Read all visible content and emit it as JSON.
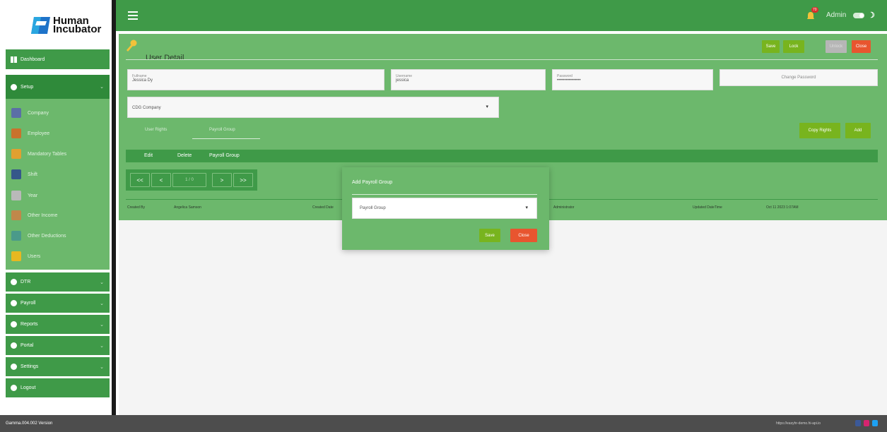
{
  "brand": {
    "line1": "Human",
    "line2": "Incubator"
  },
  "sidebar": {
    "dashboard": "Dashboard",
    "setup": "Setup",
    "setup_items": [
      {
        "label": "Company",
        "color": "#5b6fa6"
      },
      {
        "label": "Employee",
        "color": "#c9722c"
      },
      {
        "label": "Mandatory Tables",
        "color": "#e0a030"
      },
      {
        "label": "Shift",
        "color": "#35588a"
      },
      {
        "label": "Year",
        "color": "#b9b9b9"
      },
      {
        "label": "Other Income",
        "color": "#c0884a"
      },
      {
        "label": "Other Deductions",
        "color": "#4a9a8a"
      },
      {
        "label": "Users",
        "color": "#e8b820"
      }
    ],
    "menu": [
      {
        "label": "DTR"
      },
      {
        "label": "Payroll"
      },
      {
        "label": "Reports"
      },
      {
        "label": "Portal"
      },
      {
        "label": "Settings"
      },
      {
        "label": "Logout"
      }
    ]
  },
  "topbar": {
    "admin_label": "Admin",
    "notification_count": "70"
  },
  "page": {
    "title": "User Detail"
  },
  "toolbar": {
    "save": "Save",
    "lock": "Lock",
    "unlock": "Unlock",
    "close": "Close"
  },
  "form": {
    "fullname_label": "Fullname",
    "fullname_value": "Jessica Dy",
    "username_label": "Username",
    "username_value": "jessica",
    "password_label": "Password",
    "password_value": "••••••••••••••••",
    "change_password": "Change Password",
    "company_select": "CDG Company"
  },
  "tabs": {
    "user_rights": "User Rights",
    "payroll_group": "Payroll Group"
  },
  "actions": {
    "copy_rights": "Copy Rights",
    "add": "Add"
  },
  "table": {
    "headers": [
      "Edit",
      "Delete",
      "Payroll Group"
    ]
  },
  "pager": {
    "first": "<<",
    "prev": "<",
    "page": "1 / 0",
    "next": ">",
    "last": ">>"
  },
  "audit": {
    "created_by_label": "Created By",
    "created_by": "Angelica Samson",
    "created_date_label": "Created Date",
    "updated_by": "Administrator",
    "updated_dt_label": "Updated DateTime",
    "updated_dt": "Oct 11 2023 1:07AM"
  },
  "modal": {
    "title": "Add Payroll Group",
    "select": "Payroll Group",
    "save": "Save",
    "close": "Close"
  },
  "footer": {
    "version": "Gamma.004.002 Version",
    "url": "https://easyhr-demo.hi-api.io"
  },
  "colors": {
    "green": "#3f9a48",
    "light_green": "#6cb86c",
    "save": "#78b41e",
    "close": "#e8552f",
    "unlock": "#b6b6b6"
  }
}
